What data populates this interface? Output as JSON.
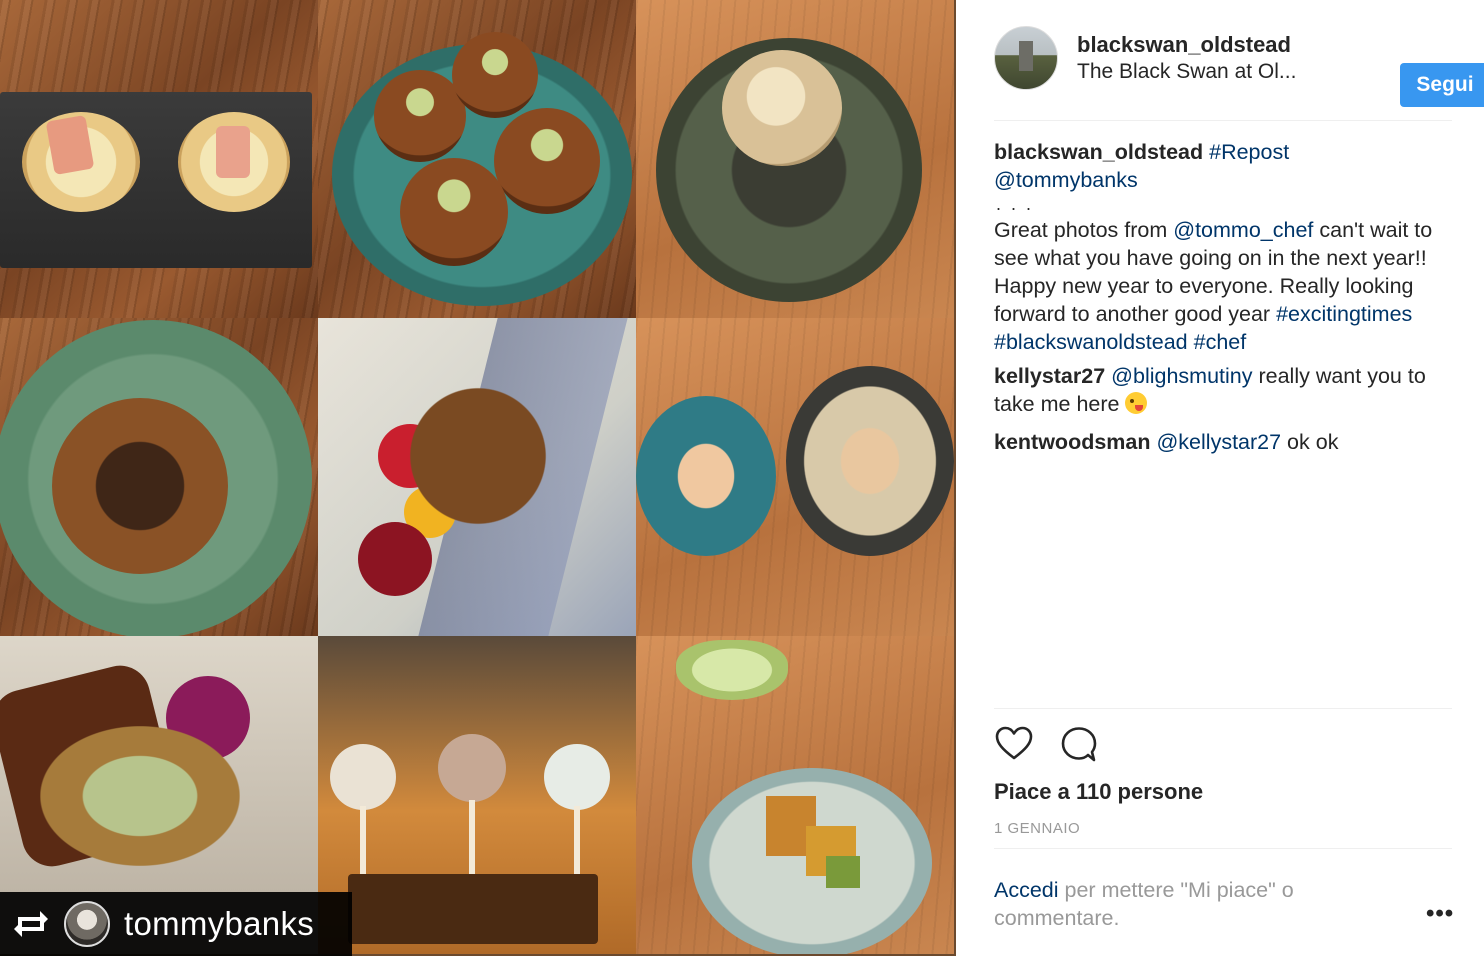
{
  "media": {
    "repost_username": "tommybanks"
  },
  "header": {
    "username": "blackswan_oldstead",
    "location": "The Black Swan at Ol...",
    "follow_label": "Segui"
  },
  "caption": {
    "username": "blackswan_oldstead",
    "tag_repost": "#Repost",
    "mention_tommybanks": "@tommybanks",
    "dots": "...",
    "text_1": "Great photos from ",
    "mention_tommo": "@tommo_chef",
    "text_2": " can't wait to see what you have going on in the next year!! Happy new year to everyone. Really looking forward to another good year ",
    "hashtags": [
      "#excitingtimes",
      "#blackswanoldstead",
      "#chef"
    ]
  },
  "comments": [
    {
      "username": "kellystar27",
      "mention": "@blighsmutiny",
      "text": " really want you to take me here "
    },
    {
      "username": "kentwoodsman",
      "mention": "@kellystar27",
      "text": " ok ok"
    }
  ],
  "likes_text": "Piace a 110 persone",
  "date": "1 GENNAIO",
  "login_prompt": {
    "link": "Accedi",
    "text": " per mettere \"Mi piace\" o commentare."
  },
  "more_options": "•••",
  "icons": {
    "like": "heart-icon",
    "comment": "comment-icon",
    "repost": "repost-icon"
  },
  "colors": {
    "follow_button": "#3897f0",
    "link": "#003569",
    "muted": "#999999"
  }
}
